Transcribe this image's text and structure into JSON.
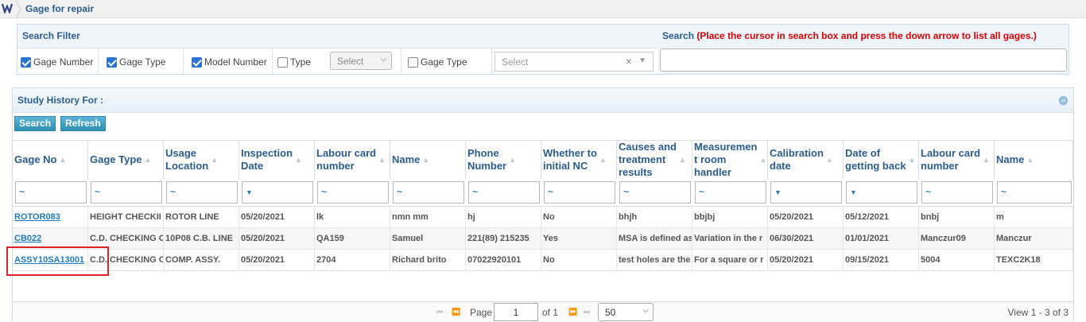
{
  "breadcrumb": {
    "title": "Gage for repair"
  },
  "filter": {
    "title": "Search Filter",
    "checkboxes": [
      {
        "label": "Gage Number",
        "checked": true
      },
      {
        "label": "Gage Type",
        "checked": true
      },
      {
        "label": "Model Number",
        "checked": true
      },
      {
        "label": "Type",
        "checked": false
      },
      {
        "label": "Gage Type",
        "checked": false
      }
    ],
    "type_select": "Select",
    "gage_type_select": "Select",
    "search_label": "Search",
    "search_hint": "(Place the cursor in search box and press the down arrow to list all gages.)",
    "search_value": ""
  },
  "panel": {
    "title": "Study History For :",
    "search_button": "Search",
    "refresh_button": "Refresh"
  },
  "grid": {
    "columns": [
      {
        "line1": "Gage No",
        "line2": ""
      },
      {
        "line1": "Gage Type",
        "line2": ""
      },
      {
        "line1": "Usage",
        "line2": "Location"
      },
      {
        "line1": "Inspection",
        "line2": "Date"
      },
      {
        "line1": "Labour card",
        "line2": "number"
      },
      {
        "line1": "Name",
        "line2": ""
      },
      {
        "line1": "Phone",
        "line2": "Number"
      },
      {
        "line1": "Whether to",
        "line2": "initial NC"
      },
      {
        "line1": "Causes and",
        "line2": "treatment",
        "line3": "results"
      },
      {
        "line1": "Measuremen",
        "line2": "t room",
        "line3": "handler"
      },
      {
        "line1": "Calibration",
        "line2": "date"
      },
      {
        "line1": "Date of",
        "line2": "getting back"
      },
      {
        "line1": "Labour card",
        "line2": "number"
      },
      {
        "line1": "Name",
        "line2": ""
      }
    ],
    "filter_symbols": [
      "~",
      "~",
      "~",
      "▼",
      "~",
      "~",
      "~",
      "~",
      "~",
      "~",
      "▼",
      "▼",
      "~",
      "~"
    ],
    "rows": [
      [
        "ROTOR083",
        "HEIGHT CHECKII",
        "ROTOR LINE",
        "05/20/2021",
        "lk",
        "nmn  mm",
        "hj",
        "No",
        "bhjh",
        "bbjbj",
        "05/20/2021",
        "05/12/2021",
        "bnbj",
        " m"
      ],
      [
        "CB022",
        "C.D. CHECKING C",
        "10P08 C.B. LINE",
        "05/20/2021",
        "QA159",
        "Samuel",
        "221(89) 215235",
        "Yes",
        "MSA is defined as",
        "Variation in the r",
        "06/30/2021",
        "01/01/2021",
        " Manczur09",
        " Manczur"
      ],
      [
        "ASSY10SA13001",
        "C.D. CHECKING C",
        "COMP. ASSY.",
        "05/20/2021",
        "2704",
        "Richard brito",
        "07022920101",
        "No",
        "test holes are the",
        "For a square or r",
        "05/20/2021",
        "09/15/2021",
        "5004",
        "TEXC2K18"
      ]
    ]
  },
  "pager": {
    "page_label": "Page",
    "page_value": "1",
    "of_label": "of 1",
    "page_size": "50",
    "view_records": "View 1 - 3 of 3"
  },
  "colors": {
    "accent": "#2a5d8f",
    "link": "#1f7ac0",
    "hint": "#e00000",
    "button": "#3a9cc4"
  }
}
